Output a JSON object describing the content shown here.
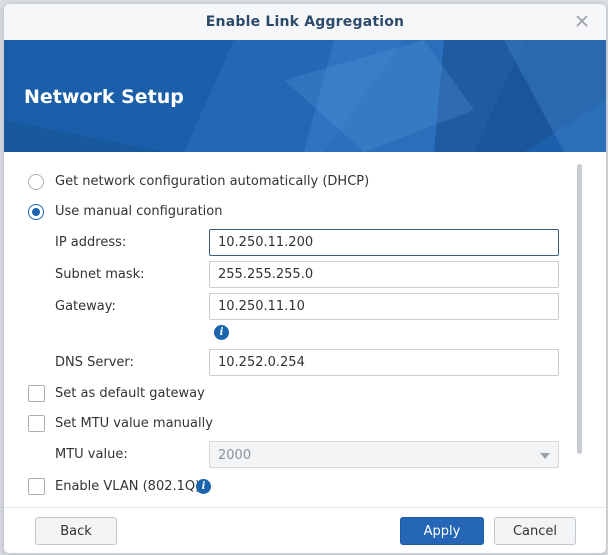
{
  "dialog": {
    "title": "Enable Link Aggregation"
  },
  "banner": {
    "title": "Network Setup"
  },
  "options": {
    "dhcp_label": "Get network configuration automatically (DHCP)",
    "dhcp_selected": false,
    "manual_label": "Use manual configuration",
    "manual_selected": true
  },
  "fields": {
    "ip_label": "IP address:",
    "ip_value": "10.250.11.200",
    "subnet_label": "Subnet mask:",
    "subnet_value": "255.255.255.0",
    "gateway_label": "Gateway:",
    "gateway_value": "10.250.11.10",
    "dns_label": "DNS Server:",
    "dns_value": "10.252.0.254"
  },
  "checkboxes": {
    "default_gateway_label": "Set as default gateway",
    "default_gateway_checked": false,
    "mtu_manual_label": "Set MTU value manually",
    "mtu_manual_checked": false,
    "mtu_value_label": "MTU value:",
    "mtu_value": "2000",
    "vlan_label": "Enable VLAN (802.1Q)",
    "vlan_checked": false
  },
  "buttons": {
    "back": "Back",
    "apply": "Apply",
    "cancel": "Cancel"
  },
  "icons": {
    "close": "close-icon",
    "info": "info-icon",
    "dropdown": "chevron-down-icon"
  },
  "colors": {
    "accent": "#1a63ad",
    "banner": "#1b5faa",
    "primary_button": "#2566b6",
    "title_text": "#2e4a6b"
  }
}
